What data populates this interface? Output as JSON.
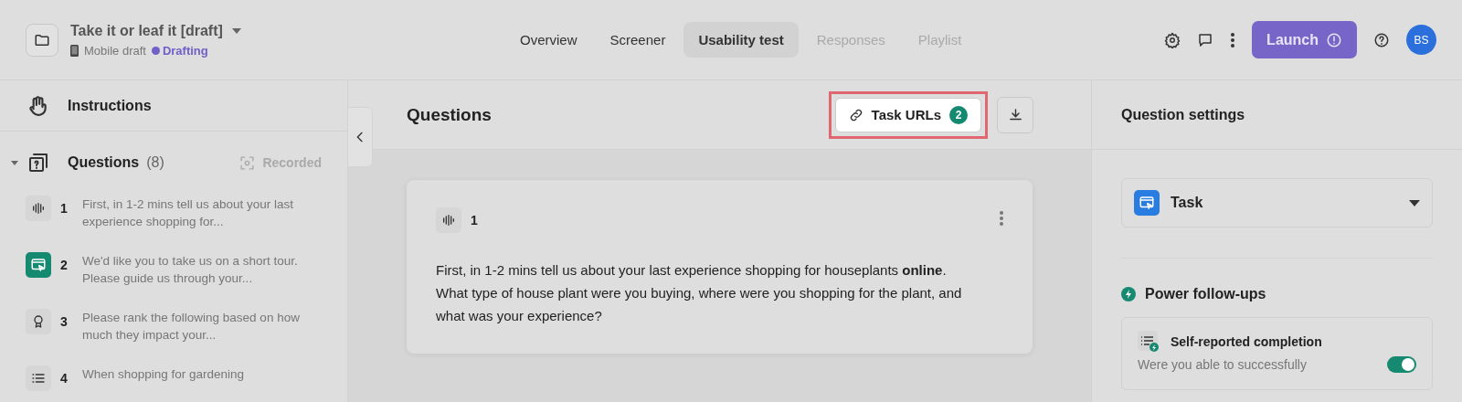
{
  "project": {
    "title": "Take it or leaf it [draft]",
    "device": "Mobile draft",
    "status": "Drafting"
  },
  "tabs": [
    {
      "label": "Overview",
      "selected": false,
      "disabled": false
    },
    {
      "label": "Screener",
      "selected": false,
      "disabled": false
    },
    {
      "label": "Usability test",
      "selected": true,
      "disabled": false
    },
    {
      "label": "Responses",
      "selected": false,
      "disabled": true
    },
    {
      "label": "Playlist",
      "selected": false,
      "disabled": true
    }
  ],
  "launch_button": "Launch",
  "avatar": "BS",
  "sidebar": {
    "instructions": "Instructions",
    "questions_label": "Questions",
    "questions_count": "(8)",
    "recorded": "Recorded",
    "expanded": true,
    "items": [
      {
        "kind": "audio",
        "number": "1",
        "text": "First, in 1-2 mins tell us about your last experience shopping for...",
        "selected": false
      },
      {
        "kind": "task",
        "number": "2",
        "text": "We'd like you to take us on a short tour. Please guide us through your...",
        "selected": true
      },
      {
        "kind": "rank",
        "number": "3",
        "text": "Please rank the following based on how much they impact your...",
        "selected": false
      },
      {
        "kind": "list",
        "number": "4",
        "text": "When shopping for gardening",
        "selected": false
      }
    ]
  },
  "main": {
    "title": "Questions",
    "task_urls_button": "Task URLs",
    "task_urls_count": "2",
    "card": {
      "kind": "audio",
      "number": "1",
      "text": "First, in 1-2 mins tell us about your last experience shopping for houseplants **online**. What type of house plant were you buying, where were you shopping for the plant, and what was your experience?"
    }
  },
  "settings": {
    "title": "Question settings",
    "type": "Task",
    "power_title": "Power follow-ups",
    "followup": {
      "title": "Self-reported completion",
      "question": "Were you able to successfully",
      "on": true
    }
  }
}
